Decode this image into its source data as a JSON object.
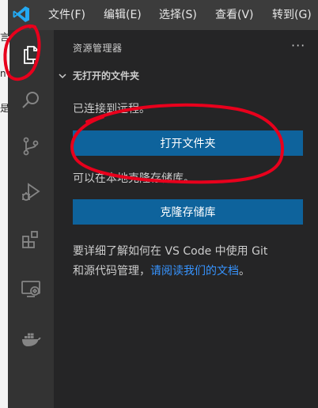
{
  "menu": {
    "items": [
      {
        "label": "文件(F)"
      },
      {
        "label": "编辑(E)"
      },
      {
        "label": "选择(S)"
      },
      {
        "label": "查看(V)"
      },
      {
        "label": "转到(G)"
      }
    ]
  },
  "background_fragments": [
    "言",
    "n",
    "是"
  ],
  "activity_bar": {
    "items": [
      {
        "name": "explorer",
        "icon": "files-icon",
        "active": true
      },
      {
        "name": "search",
        "icon": "search-icon"
      },
      {
        "name": "source-control",
        "icon": "source-control-icon"
      },
      {
        "name": "run-and-debug",
        "icon": "run-debug-icon"
      },
      {
        "name": "extensions",
        "icon": "extensions-icon"
      },
      {
        "name": "remote-explorer",
        "icon": "remote-explorer-icon"
      },
      {
        "name": "docker",
        "icon": "docker-icon"
      }
    ]
  },
  "sidebar": {
    "title": "资源管理器",
    "more_label": "···",
    "section": {
      "title": "无打开的文件夹"
    },
    "not_connected_msg": "已连接到远程。",
    "open_folder_button": "打开文件夹",
    "clone_msg": "可以在本地克隆存储库。",
    "clone_button": "克隆存储库",
    "help": {
      "line1": "要详细了解如何在 VS Code 中使用 Git",
      "line2_prefix": "和源代码管理，",
      "link": "请阅读我们的文档",
      "suffix": "。"
    }
  },
  "colors": {
    "menubar": "#3c3c3c",
    "activity_bar": "#333333",
    "sidebar": "#252526",
    "button": "#0e639c",
    "link": "#3794ff",
    "annotation": "#e8001c"
  }
}
